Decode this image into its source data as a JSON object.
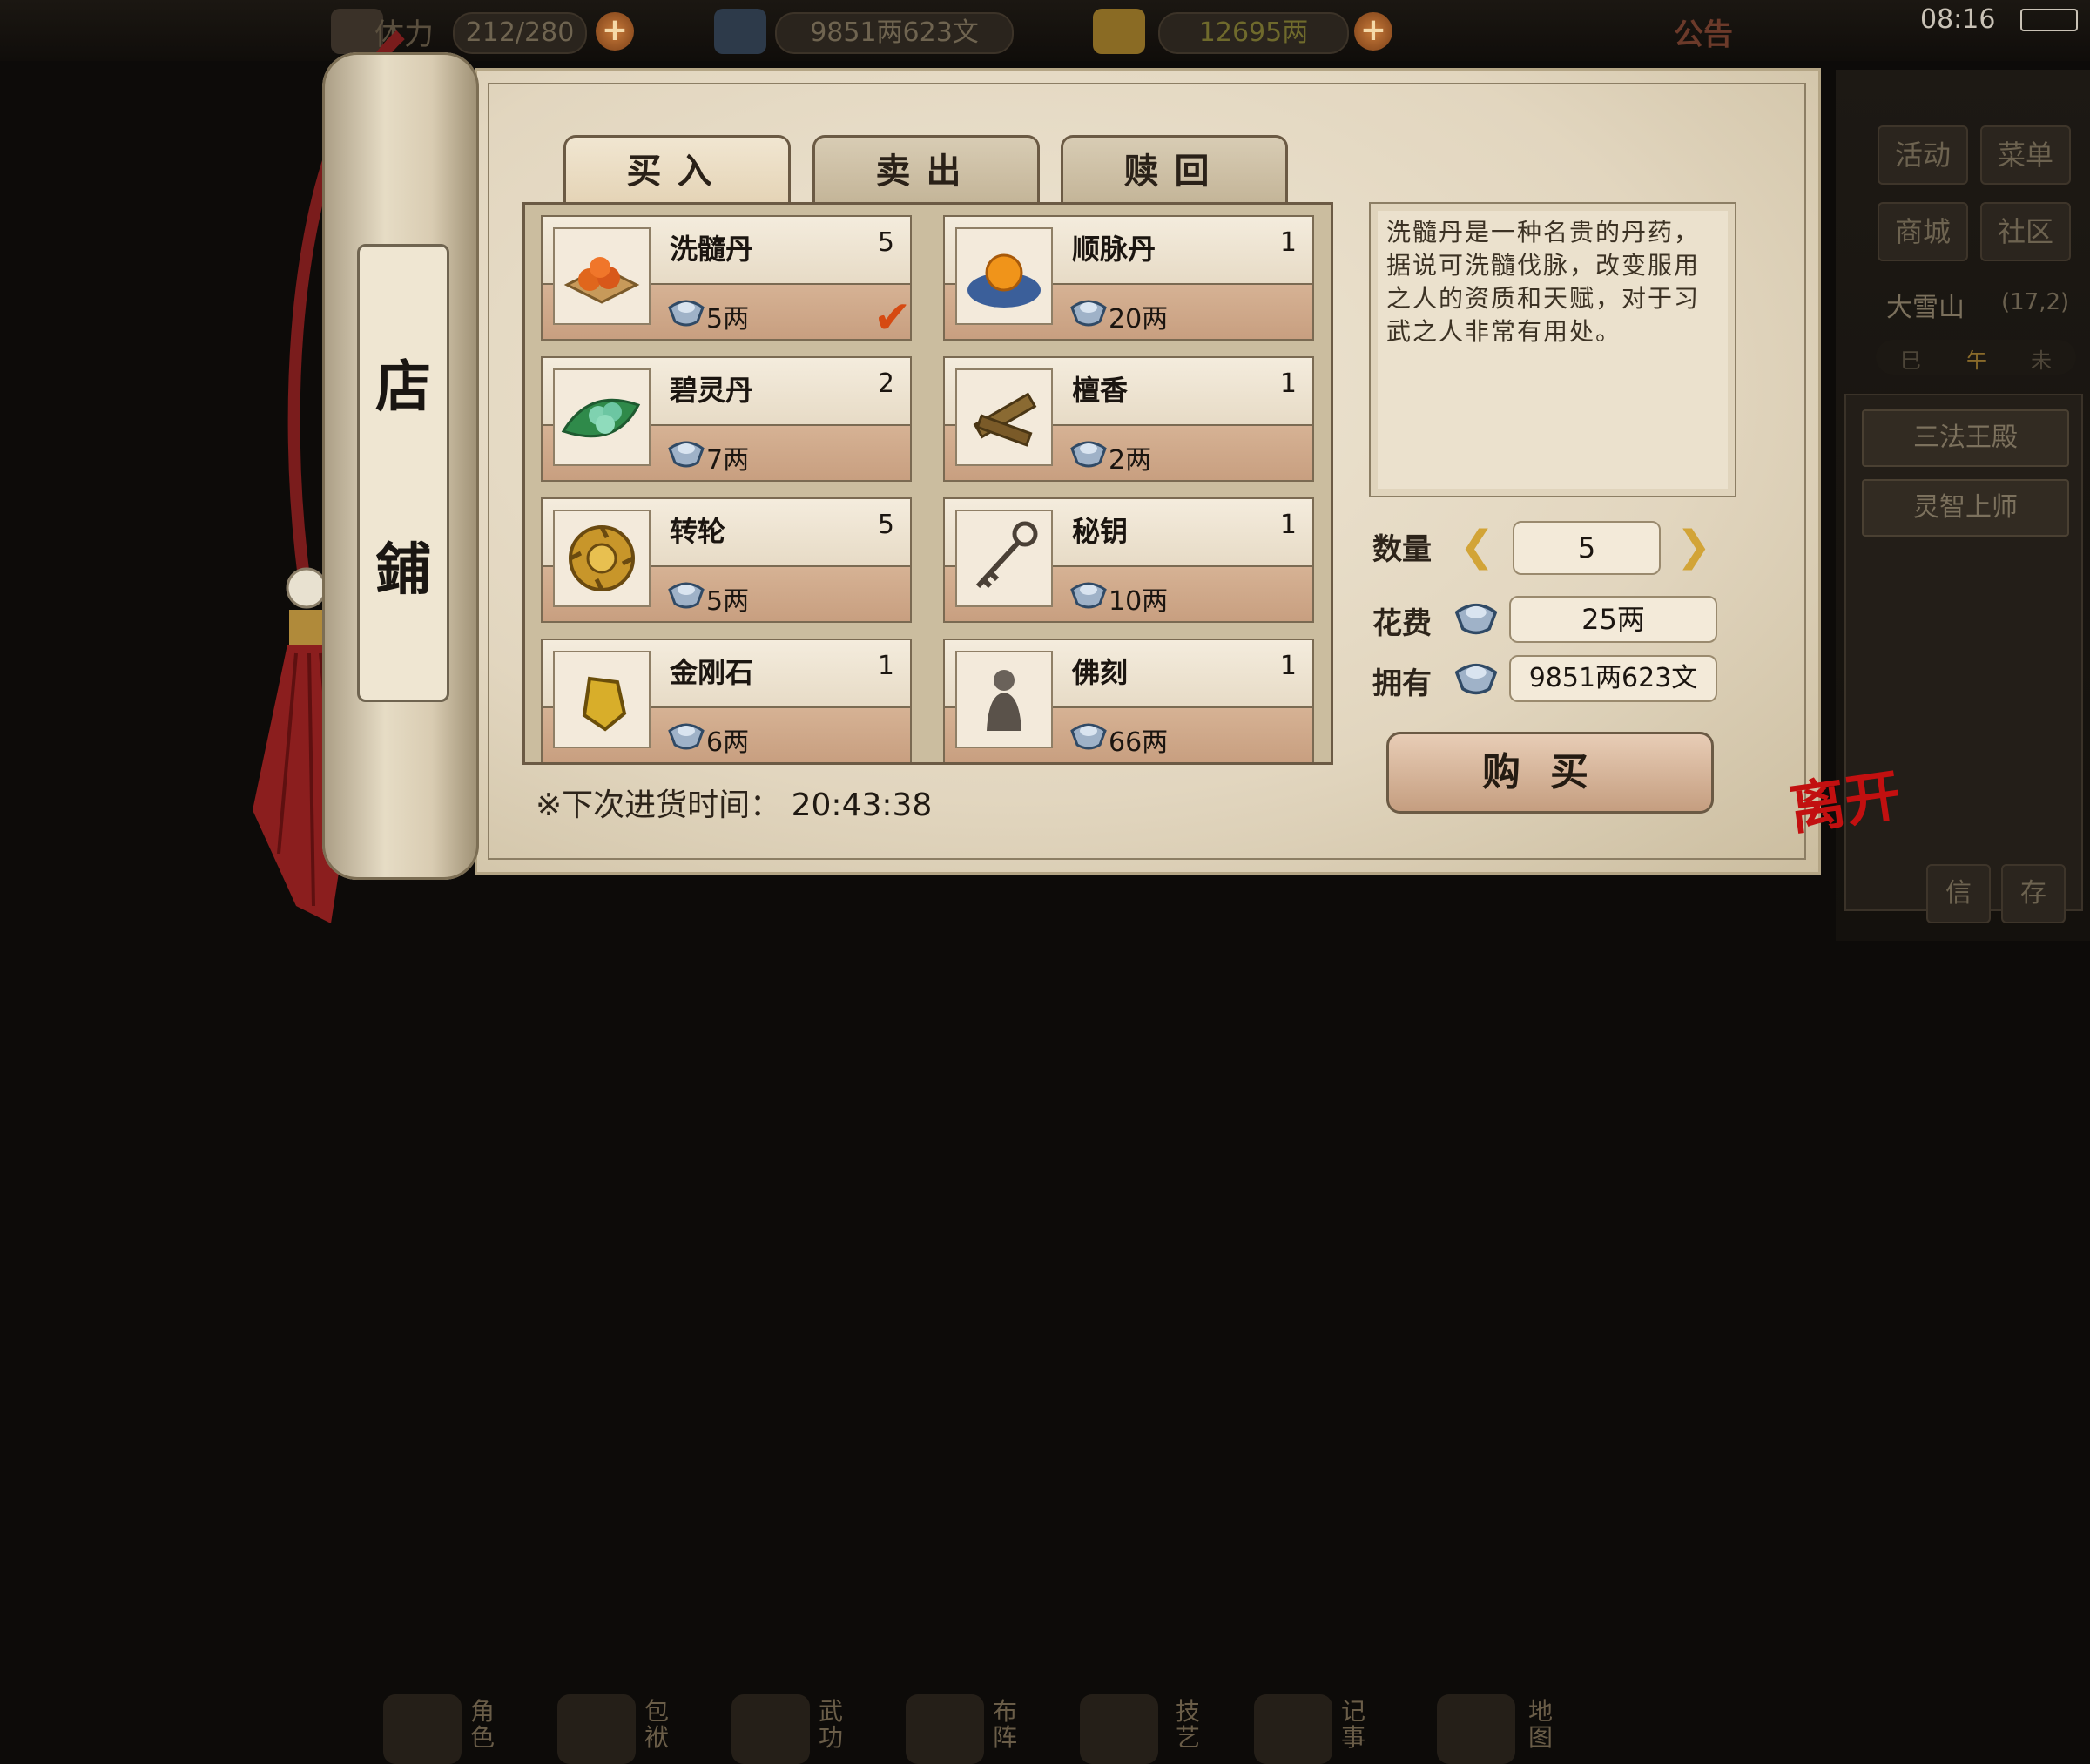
{
  "topbar": {
    "stamina": "212/280",
    "stamina_label": "体力",
    "silver": "9851两623文",
    "gold": "12695两",
    "notice": "公告",
    "time": "08:16"
  },
  "right_panel": {
    "activity": "活动",
    "menu": "菜单",
    "mall": "商城",
    "community": "社区",
    "location": "大雪山",
    "coords": "(17,2)",
    "time_marks": [
      "巳",
      "午",
      "未"
    ],
    "quests": [
      "三法王殿",
      "灵智上师"
    ],
    "mail": "信",
    "save": "存"
  },
  "bottom_bar": [
    {
      "label": "角色"
    },
    {
      "label": "包袱"
    },
    {
      "label": "武功"
    },
    {
      "label": "布阵"
    },
    {
      "label": "技艺"
    },
    {
      "label": "记事"
    },
    {
      "label": "地图"
    }
  ],
  "scroll": {
    "title_top": "店",
    "title_bottom": "鋪"
  },
  "tabs": {
    "buy": "买入",
    "sell": "卖出",
    "redeem": "赎回"
  },
  "items": [
    {
      "name": "洗髓丹",
      "qty": "5",
      "price": "5两",
      "selected": true
    },
    {
      "name": "顺脉丹",
      "qty": "1",
      "price": "20两"
    },
    {
      "name": "碧灵丹",
      "qty": "2",
      "price": "7两"
    },
    {
      "name": "檀香",
      "qty": "1",
      "price": "2两"
    },
    {
      "name": "转轮",
      "qty": "5",
      "price": "5两"
    },
    {
      "name": "秘钥",
      "qty": "1",
      "price": "10两"
    },
    {
      "name": "金刚石",
      "qty": "1",
      "price": "6两"
    },
    {
      "name": "佛刻",
      "qty": "1",
      "price": "66两"
    }
  ],
  "restock": {
    "label": "※下次进货时间：",
    "time": "20:43:38"
  },
  "detail": {
    "description": "洗髓丹是一种名贵的丹药，据说可洗髓伐脉，改变服用之人的资质和天赋，对于习武之人非常有用处。",
    "qty_label": "数量",
    "qty_value": "5",
    "cost_label": "花费",
    "cost_value": "25两",
    "own_label": "拥有",
    "own_value": "9851两623文",
    "buy_button": "购买"
  },
  "leave_label": "离开",
  "colors": {
    "accent_red": "#c21010",
    "paper": "#e2d6bf",
    "check": "#d64a12"
  }
}
